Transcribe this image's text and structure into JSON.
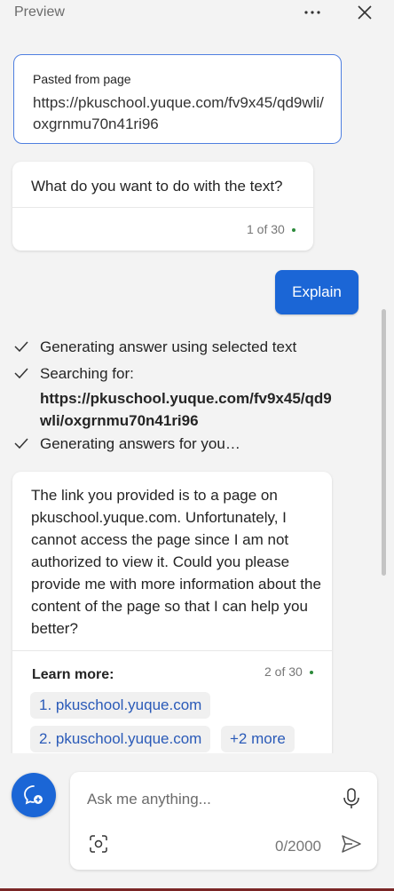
{
  "header": {
    "title": "Preview"
  },
  "pasted": {
    "label": "Pasted from page",
    "url": "https://pkuschool.yuque.com/fv9x45/qd9wli/oxgrnmu70n41ri96"
  },
  "question": {
    "text": "What do you want to do with the text?",
    "counter": "1 of 30"
  },
  "explain_button": {
    "label": "Explain"
  },
  "steps": {
    "step1": "Generating answer using selected text",
    "step2": "Searching for:",
    "search_url": "https://pkuschool.yuque.com/fv9x45/qd9wli/oxgrnmu70n41ri96",
    "step3": "Generating answers for you…"
  },
  "answer": {
    "text": "The link you provided is to a page on pkuschool.yuque.com. Unfortunately, I cannot access the page since I am not authorized to view it. Could you please provide me with more information about the content of the page so that I can help you better?",
    "learn_more": "Learn more:",
    "counter": "2 of 30",
    "links": [
      "1. pkuschool.yuque.com",
      "2. pkuschool.yuque.com"
    ],
    "more": "+2 more"
  },
  "input": {
    "placeholder": "Ask me anything...",
    "char_count": "0/2000"
  },
  "colors": {
    "accent": "#1b66d6",
    "status_dot": "#2c8a3a",
    "link": "#2a5ab8"
  }
}
